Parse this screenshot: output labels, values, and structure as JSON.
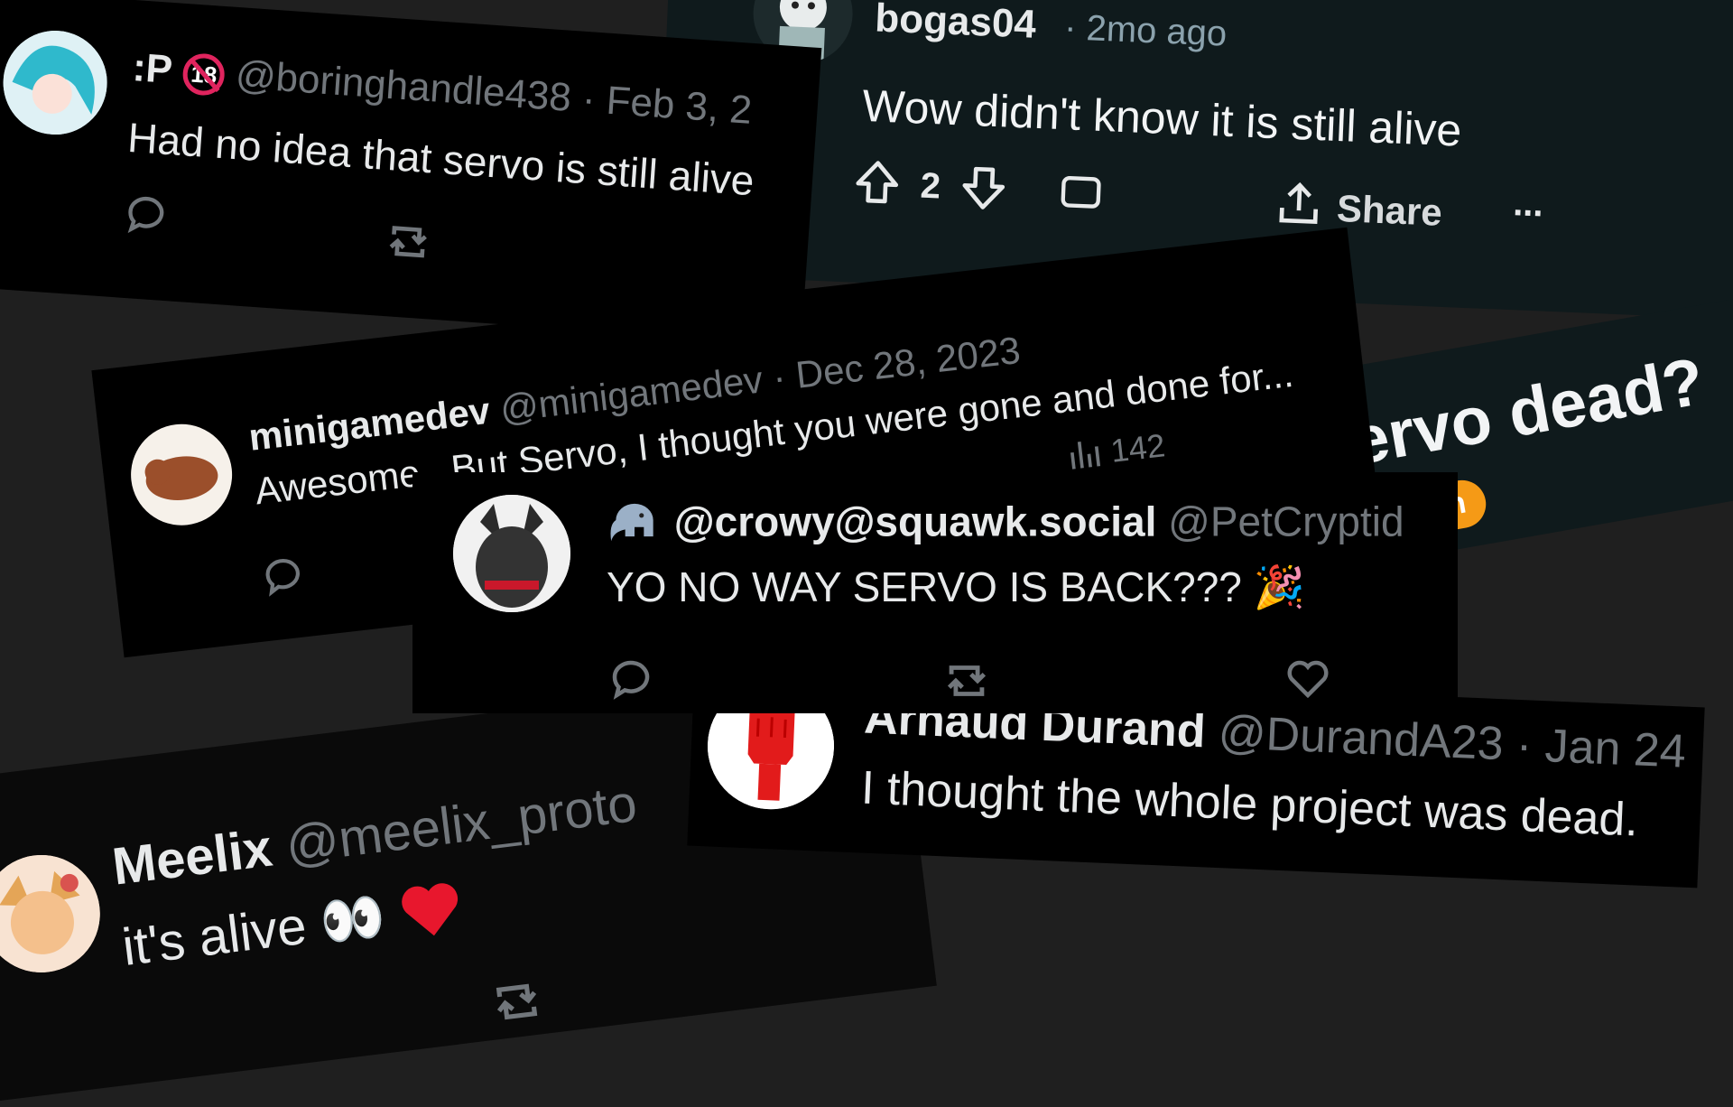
{
  "cards": {
    "boring": {
      "name": ":P",
      "handle": "@boringhandle438",
      "date": "· Feb 3, 2",
      "text": "Had no idea that servo is still alive"
    },
    "bogas": {
      "name": "bogas04",
      "time": "· 2mo ago",
      "text": "Wow didn't know it is still alive",
      "votes": "2",
      "share": "Share",
      "more": "..."
    },
    "servo": {
      "title": "Servo dead?",
      "tag": "sion"
    },
    "minigame": {
      "name": "minigamedev",
      "handle": "@minigamedev",
      "date": "· Dec 28, 2023",
      "text": "Awesome.. But Servo, I thought you were gone and done for...",
      "views": "142"
    },
    "crowy": {
      "name": "@crowy@squawk.social",
      "handle": "@PetCryptid",
      "text": "YO NO WAY SERVO IS BACK???",
      "emoji": "🎉"
    },
    "meelix": {
      "name": "Meelix",
      "handle": "@meelix_proto",
      "text": "it's alive",
      "emoji": "👀"
    },
    "arnaud": {
      "name": "Arnaud Durand",
      "handle": "@DurandA23",
      "date": "· Jan 24",
      "text": "I thought the whole project was dead."
    }
  },
  "colors": {
    "background": "#1f1f1f",
    "tweet_bg": "#000000",
    "reddit_bg": "#0f1a1c",
    "muted": "#71767b",
    "accent_orange": "#f59a16",
    "heart_red": "#f91880"
  }
}
